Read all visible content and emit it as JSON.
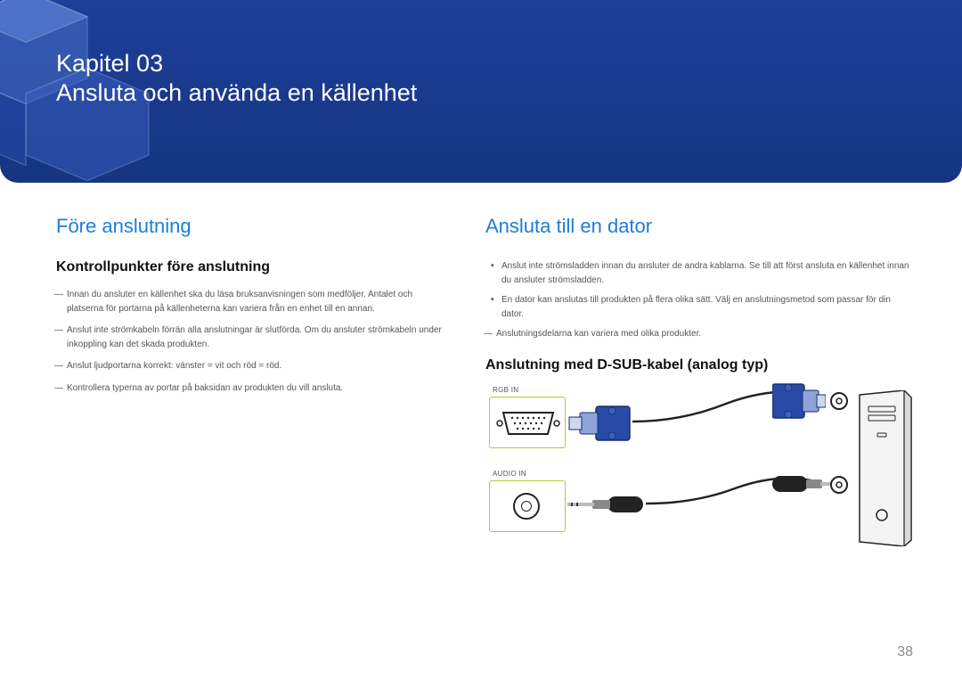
{
  "header": {
    "chapter_label": "Kapitel 03",
    "chapter_title": "Ansluta och använda en källenhet"
  },
  "left": {
    "title": "Före anslutning",
    "subtitle": "Kontrollpunkter före anslutning",
    "notes": [
      "Innan du ansluter en källenhet ska du läsa bruksanvisningen som medföljer. Antalet och platserna för portarna på källenheterna kan variera från en enhet till en annan.",
      "Anslut inte strömkabeln förrän alla anslutningar är slutförda. Om du ansluter strömkabeln under inkoppling kan det skada produkten.",
      "Anslut ljudportarna korrekt: vänster = vit och röd = röd.",
      "Kontrollera typerna av portar på baksidan av produkten du vill ansluta."
    ]
  },
  "right": {
    "title": "Ansluta till en dator",
    "bullets": [
      "Anslut inte strömsladden innan du ansluter de andra kablarna. Se till att först ansluta en källenhet innan du ansluter strömsladden.",
      "En dator kan anslutas till produkten på flera olika sätt. Välj en anslutningsmetod som passar för din dator."
    ],
    "note": "Anslutningsdelarna kan variera med olika produkter.",
    "subtitle": "Anslutning med D-SUB-kabel (analog typ)",
    "port_rgb": "RGB IN",
    "port_audio": "AUDIO IN"
  },
  "page_number": "38"
}
